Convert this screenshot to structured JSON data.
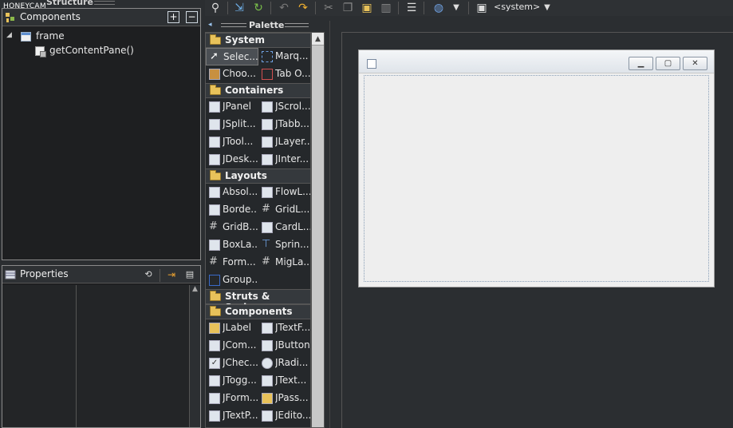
{
  "watermark": "HONEYCAM",
  "structure": {
    "title": "Structure"
  },
  "components_panel": {
    "title": "Components",
    "tree": [
      {
        "label": "frame",
        "level": 0,
        "expanded": true
      },
      {
        "label": "getContentPane()",
        "level": 1
      }
    ]
  },
  "properties_panel": {
    "title": "Properties"
  },
  "toolbar": {
    "look_and_feel": "<system>"
  },
  "palette": {
    "title": "Palette",
    "categories": [
      {
        "name": "System",
        "items": [
          "Selec...",
          "Marq...",
          "Choo...",
          "Tab O..."
        ]
      },
      {
        "name": "Containers",
        "items": [
          "JPanel",
          "JScrol...",
          "JSplit...",
          "JTabb...",
          "JTool...",
          "JLayer...",
          "JDesk...",
          "JInter..."
        ]
      },
      {
        "name": "Layouts",
        "items": [
          "Absol...",
          "FlowL...",
          "Borde...",
          "GridL...",
          "GridB...",
          "CardL...",
          "BoxLa...",
          "Sprin...",
          "Form...",
          "MigLa...",
          "Group..."
        ]
      },
      {
        "name": "Struts & Springs",
        "items": []
      },
      {
        "name": "Components",
        "items": [
          "JLabel",
          "JTextF...",
          "JCom...",
          "JButton",
          "JChec...",
          "JRadi...",
          "JTogg...",
          "JText...",
          "JForm...",
          "JPass...",
          "JTextP...",
          "JEdito..."
        ]
      }
    ]
  }
}
